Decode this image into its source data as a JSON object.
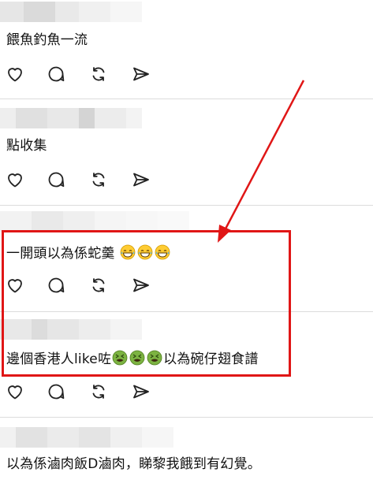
{
  "comments": [
    {
      "text": "餵魚釣魚一流",
      "emojis": [],
      "suffix": ""
    },
    {
      "text": "點收集",
      "emojis": [],
      "suffix": ""
    },
    {
      "text": "一開頭以為係蛇羹",
      "emojis": [
        "laughing-tears",
        "laughing-tears",
        "laughing-tears"
      ],
      "suffix": ""
    },
    {
      "text": "邊個香港人like咗",
      "emojis": [
        "nauseated",
        "nauseated",
        "nauseated"
      ],
      "suffix": "以為碗仔翅食譜"
    },
    {
      "text": "以為係滷肉飯D滷肉，睇黎我餓到有幻覺。",
      "emojis": [],
      "suffix": ""
    }
  ],
  "action_icons": [
    "heart-icon",
    "comment-icon",
    "repost-icon",
    "send-icon"
  ],
  "annotation": {
    "box_color": "#e01616",
    "arrow_color": "#e01616"
  }
}
